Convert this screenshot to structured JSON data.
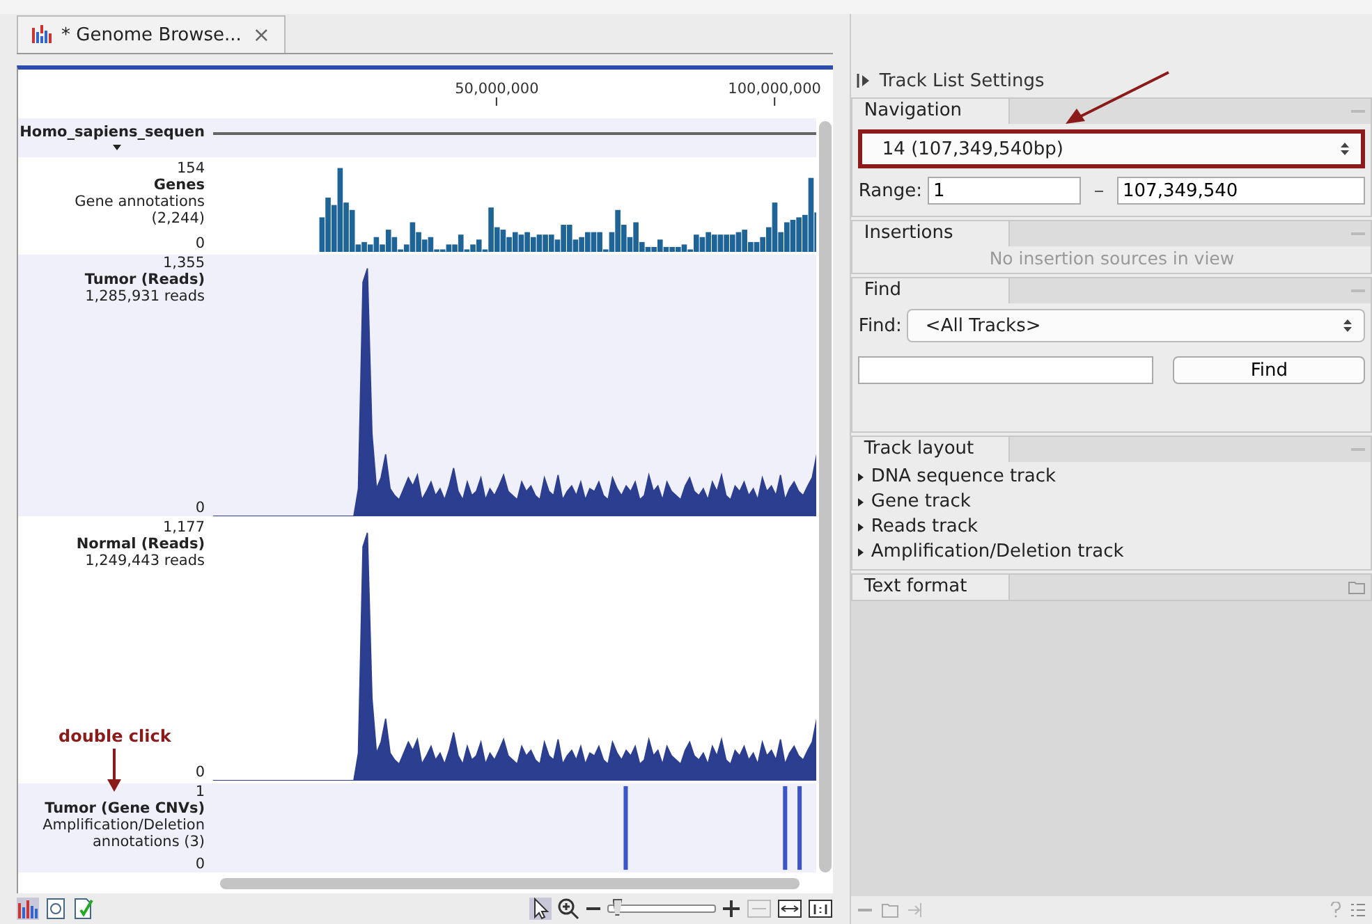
{
  "tab": {
    "title": "* Genome Browse...",
    "close": "×"
  },
  "ruler": {
    "ticks": [
      "50,000,000",
      "100,000,000"
    ]
  },
  "tracks": [
    {
      "kind": "sequence",
      "name": "Homo_sapiens_sequen"
    },
    {
      "kind": "genes",
      "max": "154",
      "name": "Genes",
      "description": [
        "Gene annotations",
        "(2,244)"
      ],
      "min": "0"
    },
    {
      "kind": "reads",
      "max": "1,355",
      "name": "Tumor (Reads)",
      "description": [
        "1,285,931 reads"
      ],
      "min": "0"
    },
    {
      "kind": "reads",
      "max": "1,177",
      "name": "Normal (Reads)",
      "description": [
        "1,249,443 reads"
      ],
      "min": "0"
    },
    {
      "kind": "cnv",
      "max": "1",
      "name": "Tumor (Gene CNVs)",
      "description": [
        "Amplification/Deletion",
        "annotations (3)"
      ],
      "min": "0"
    }
  ],
  "annotation": {
    "text": "double click"
  },
  "zoom_slider": {
    "level": 0.03
  },
  "settings": {
    "title": "Track List Settings",
    "navigation": {
      "title": "Navigation",
      "sequence": "14 (107,349,540bp)",
      "range_label": "Range:",
      "range_start": "1",
      "range_end": "107,349,540"
    },
    "insertions": {
      "title": "Insertions",
      "empty": "No insertion sources in view"
    },
    "find": {
      "title": "Find",
      "label": "Find:",
      "scope": "<All Tracks>",
      "button": "Find"
    },
    "track_layout": {
      "title": "Track layout",
      "items": [
        {
          "label": "DNA sequence track",
          "expanded": false
        },
        {
          "label": "Gene track",
          "expanded": false
        },
        {
          "label": "Reads track",
          "expanded": false
        },
        {
          "label": "Amplification/Deletion track",
          "expanded": false
        }
      ]
    },
    "text_format": {
      "title": "Text format"
    }
  }
}
